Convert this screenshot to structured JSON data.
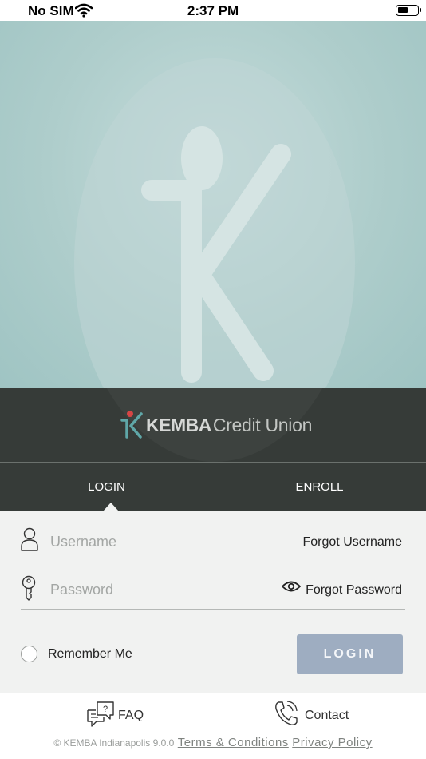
{
  "status_bar": {
    "signal": ".....",
    "carrier": "No SIM",
    "time": "2:37 PM"
  },
  "brand": {
    "name_bold": "KEMBA",
    "name_light": "Credit Union"
  },
  "tabs": [
    {
      "label": "LOGIN",
      "active": true
    },
    {
      "label": "ENROLL",
      "active": false
    }
  ],
  "form": {
    "username": {
      "placeholder": "Username",
      "value": "",
      "forgot_label": "Forgot Username"
    },
    "password": {
      "placeholder": "Password",
      "value": "",
      "forgot_label": "Forgot Password"
    },
    "remember_label": "Remember Me",
    "remember_checked": false,
    "login_button_label": "LOGIN"
  },
  "footer": {
    "faq_label": "FAQ",
    "contact_label": "Contact",
    "copyright": "© KEMBA Indianapolis 9.0.0",
    "terms_label": "Terms & Conditions",
    "privacy_label": "Privacy Policy"
  },
  "colors": {
    "brand_dark": "#363b38",
    "hero_teal": "#aecdcb",
    "form_bg": "#f1f2f1",
    "login_button": "#9eadc1",
    "logo_accent": "#d64545",
    "logo_teal": "#5fa7a8"
  },
  "icons": [
    "wifi-icon",
    "battery-icon",
    "user-icon",
    "key-icon",
    "eye-icon",
    "faq-chat-icon",
    "phone-icon"
  ]
}
